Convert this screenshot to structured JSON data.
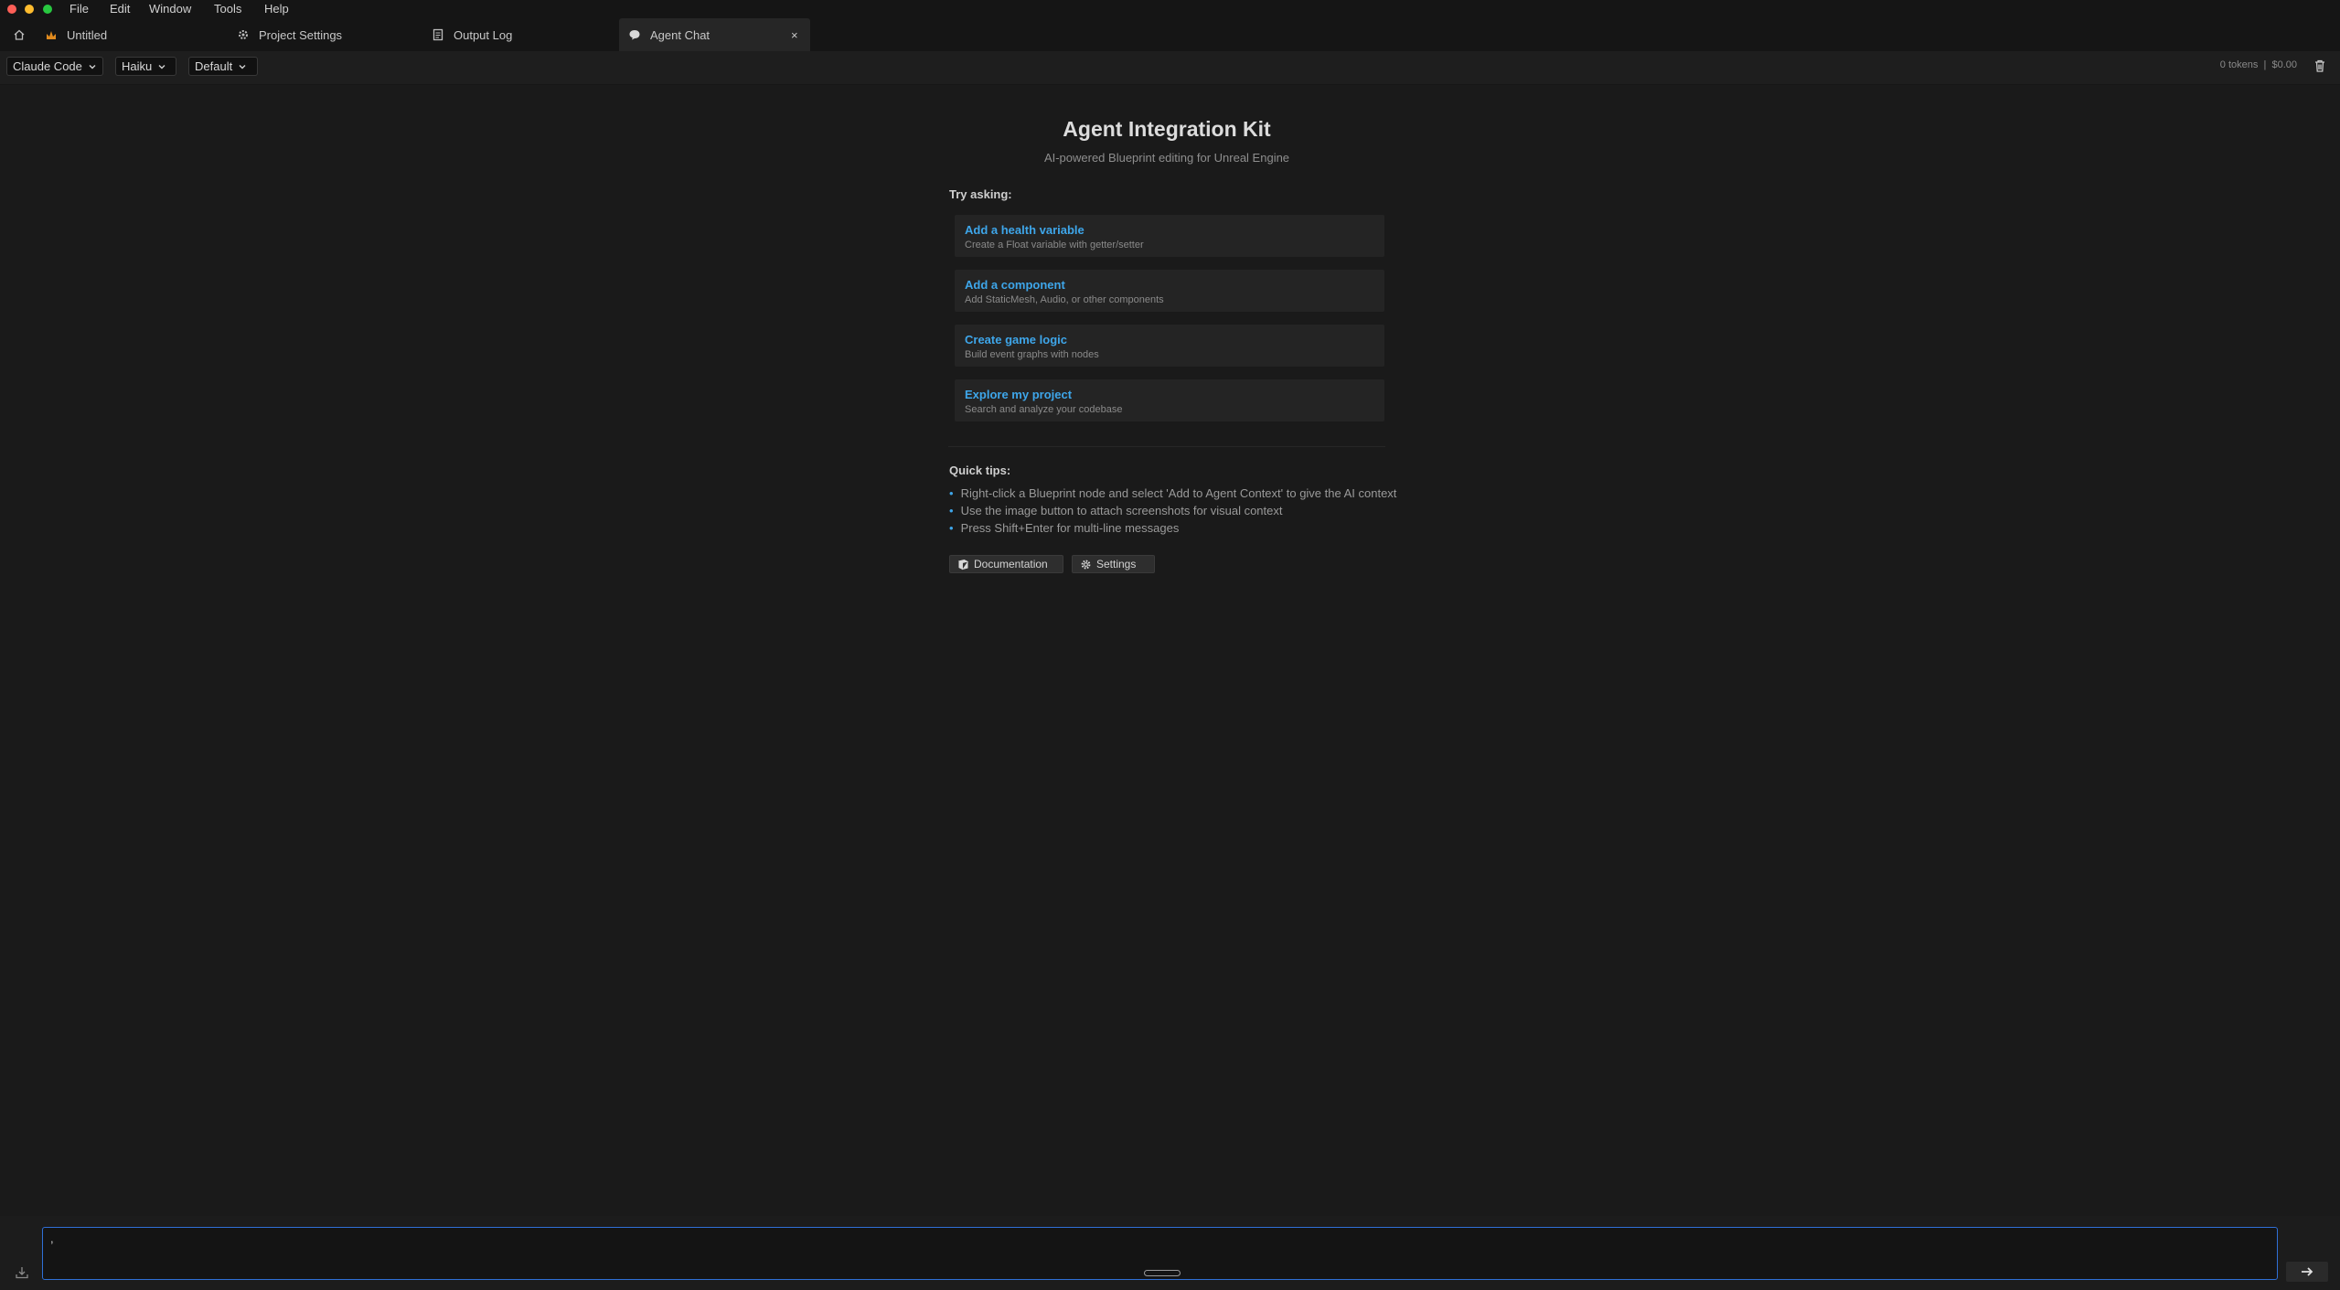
{
  "menu": [
    "File",
    "Edit",
    "Window",
    "Tools",
    "Help"
  ],
  "tabs": {
    "untitled": "Untitled",
    "project_settings": "Project Settings",
    "output_log": "Output Log",
    "agent_chat": "Agent Chat",
    "close_glyph": "×"
  },
  "toolbar": {
    "agent": "Claude Code",
    "model": "Haiku",
    "mode": "Default",
    "usage": "0 tokens  |  $0.00"
  },
  "main": {
    "title": "Agent Integration Kit",
    "subtitle": "AI-powered Blueprint editing for Unreal Engine",
    "try_asking": "Try asking:",
    "suggestions": [
      {
        "title": "Add a health variable",
        "desc": "Create a Float variable with getter/setter"
      },
      {
        "title": "Add a component",
        "desc": "Add StaticMesh, Audio, or other components"
      },
      {
        "title": "Create game logic",
        "desc": "Build event graphs with nodes"
      },
      {
        "title": "Explore my project",
        "desc": "Search and analyze your codebase"
      }
    ],
    "quick_tips": "Quick tips:",
    "tips": [
      "Right-click a Blueprint node and select 'Add to Agent Context' to give the AI context",
      "Use the image button to attach screenshots for visual context",
      "Press Shift+Enter for multi-line messages"
    ],
    "bullet": "•",
    "documentation_label": "Documentation",
    "settings_label": "Settings"
  },
  "input": {
    "value": ","
  },
  "colors": {
    "accent_link": "#3ea6ea",
    "input_border": "#2f6fd6",
    "background": "#1a1a1a"
  },
  "icons": {
    "home": "home-icon",
    "unreal_logo": "unreal-logo-icon",
    "project_settings": "settings-gear-icon",
    "output_log": "log-icon",
    "agent_chat": "chat-bubble-icon",
    "trash": "trash-icon",
    "documentation": "book-icon",
    "settings": "gear-icon",
    "send": "arrow-right-icon",
    "attach": "attach-image-icon"
  }
}
